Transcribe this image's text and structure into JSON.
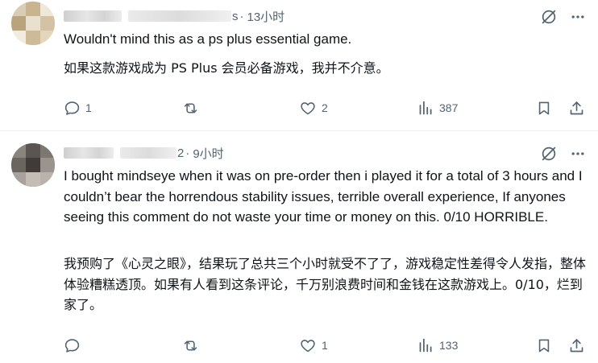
{
  "posts": [
    {
      "time": "13小时",
      "text_en": "Wouldn't mind this as a ps plus essential game.",
      "text_zh": "如果这款游戏成为 PS Plus 会员必备游戏，我并不介意。",
      "handle_tail": "s",
      "actions": {
        "replies": "1",
        "reposts": "",
        "likes": "2",
        "views": "387"
      }
    },
    {
      "time": "9小时",
      "text_en": "I bought mindseye when it was on pre-order then i played it for a total of 3 hours and I couldn’t bear the horrendous stability issues, terrible overall experience, If anyones seeing this comment do not waste your time or money on this. 0/10 HORRIBLE.",
      "text_zh": "我预购了《心灵之眼》，结果玩了总共三个小时就受不了了，游戏稳定性差得令人发指，整体体验糟糕透顶。如果有人看到这条评论，千万别浪费时间和金钱在这款游戏上。0/10，烂到家了。",
      "handle_tail": "2",
      "actions": {
        "replies": "",
        "reposts": "",
        "likes": "1",
        "views": "133"
      }
    }
  ],
  "icons": {
    "grok": "grok-icon",
    "more": "more-icon",
    "reply": "reply-icon",
    "repost": "repost-icon",
    "like": "like-icon",
    "views": "views-icon",
    "bookmark": "bookmark-icon",
    "share": "share-icon"
  },
  "colors": {
    "text": "#0f1419",
    "muted": "#536471",
    "divider": "#eff3f4"
  }
}
